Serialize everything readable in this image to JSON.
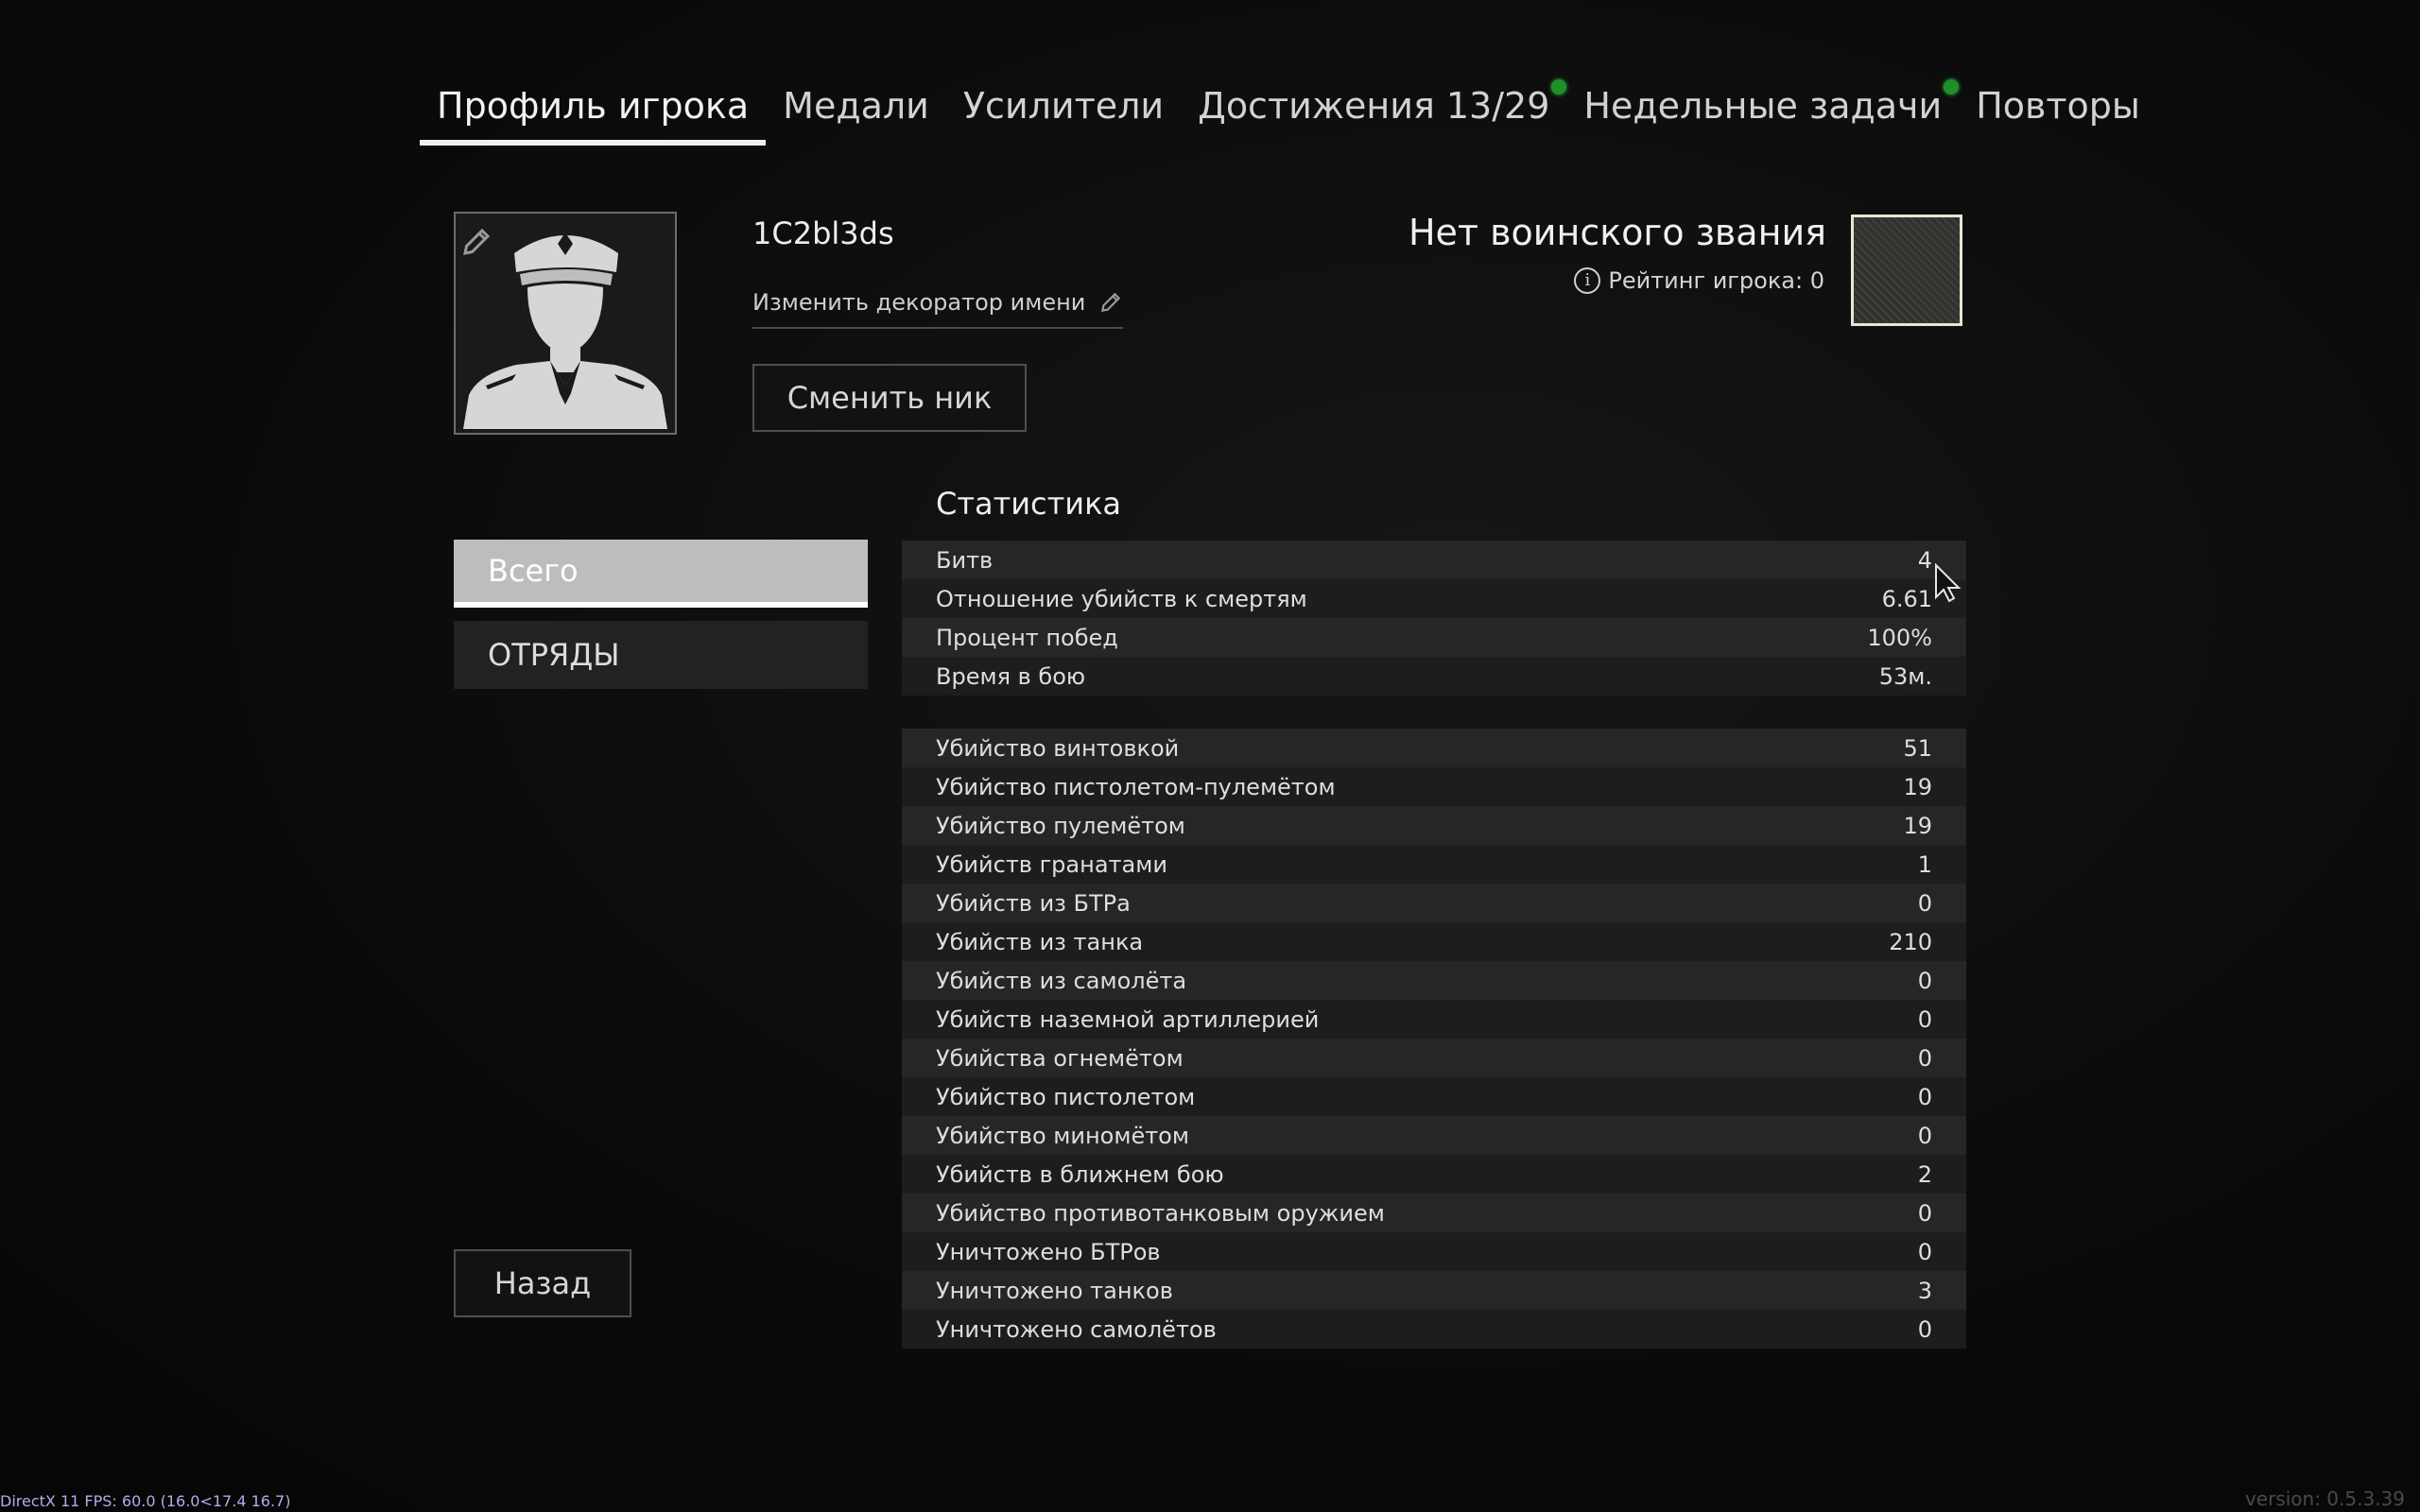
{
  "tabs": [
    {
      "label": "Профиль игрока",
      "active": true,
      "notify": false
    },
    {
      "label": "Медали",
      "active": false,
      "notify": false
    },
    {
      "label": "Усилители",
      "active": false,
      "notify": false
    },
    {
      "label": "Достижения 13/29",
      "active": false,
      "notify": true
    },
    {
      "label": "Недельные задачи",
      "active": false,
      "notify": true
    },
    {
      "label": "Повторы",
      "active": false,
      "notify": false
    }
  ],
  "profile": {
    "nickname": "1C2bl3ds",
    "change_decorator": "Изменить декоратор имени",
    "change_nick": "Сменить ник",
    "rank_title": "Нет воинского звания",
    "rating": "Рейтинг игрока: 0"
  },
  "side_tabs": [
    {
      "label": "Всего",
      "active": true
    },
    {
      "label": "ОТРЯДЫ",
      "active": false
    }
  ],
  "stats": {
    "title": "Статистика",
    "summary": [
      {
        "label": "Битв",
        "value": "4"
      },
      {
        "label": "Отношение убийств к смертям",
        "value": "6.61"
      },
      {
        "label": "Процент побед",
        "value": "100%"
      },
      {
        "label": "Время в бою",
        "value": "53м."
      }
    ],
    "details": [
      {
        "label": "Убийство винтовкой",
        "value": "51"
      },
      {
        "label": "Убийство пистолетом-пулемётом",
        "value": "19"
      },
      {
        "label": "Убийство пулемётом",
        "value": "19"
      },
      {
        "label": "Убийств гранатами",
        "value": "1"
      },
      {
        "label": "Убийств из БТРа",
        "value": "0"
      },
      {
        "label": "Убийств из танка",
        "value": "210"
      },
      {
        "label": "Убийств из самолёта",
        "value": "0"
      },
      {
        "label": "Убийств наземной артиллерией",
        "value": "0"
      },
      {
        "label": "Убийства огнемётом",
        "value": "0"
      },
      {
        "label": "Убийство пистолетом",
        "value": "0"
      },
      {
        "label": "Убийство миномётом",
        "value": "0"
      },
      {
        "label": "Убийств в ближнем бою",
        "value": "2"
      },
      {
        "label": "Убийство противотанковым оружием",
        "value": "0"
      },
      {
        "label": "Уничтожено БТРов",
        "value": "0"
      },
      {
        "label": "Уничтожено танков",
        "value": "3"
      },
      {
        "label": "Уничтожено самолётов",
        "value": "0"
      }
    ]
  },
  "back_label": "Назад",
  "footer": {
    "fps": "DirectX 11 FPS: 60.0 (16.0<17.4 16.7)",
    "version": "version: 0.5.3.39"
  },
  "colors": {
    "notify": "#1f8f2a",
    "active_tab": "#bdbdbd"
  }
}
